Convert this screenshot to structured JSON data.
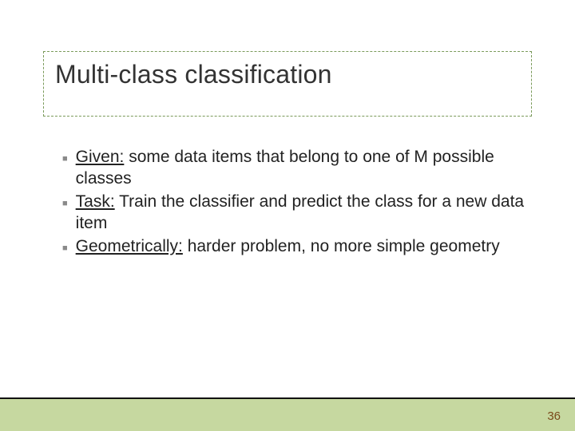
{
  "slide": {
    "title": "Multi-class classification",
    "bullets": [
      {
        "lead": "Given:",
        "rest": " some data items that belong to one of M possible classes"
      },
      {
        "lead": "Task:",
        "rest": " Train the classifier and predict the class for a new data item"
      },
      {
        "lead": "Geometrically:",
        "rest": " harder problem, no more simple geometry"
      }
    ],
    "page_number": "36"
  }
}
